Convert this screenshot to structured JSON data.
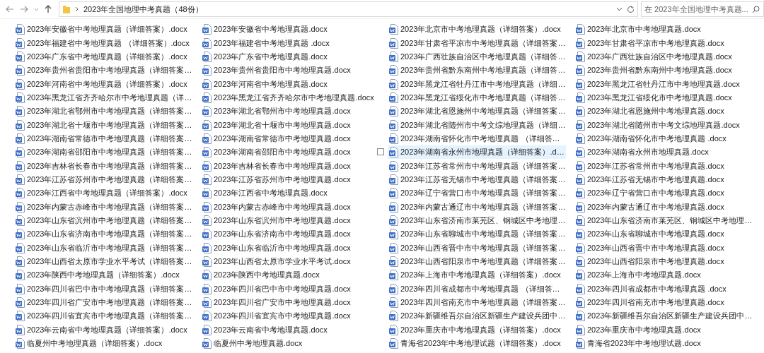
{
  "address_bar": {
    "path": "2023年全国地理中考真题（48份）"
  },
  "search": {
    "placeholder": "在 2023年全国地理中考真题..."
  },
  "columns": [
    {
      "files": [
        {
          "name": "2023年安徽省中考地理真题（详细答案）.docx",
          "selected": false
        },
        {
          "name": "2023年福建省中考地理真题 （详细答案）.docx",
          "selected": false
        },
        {
          "name": "2023年广东省中考地理真题（详细答案）.docx",
          "selected": false
        },
        {
          "name": "2023年贵州省贵阳市中考地理真题（详细答案…",
          "selected": false
        },
        {
          "name": "2023年河南省中考地理真题（详细答案）.docx",
          "selected": false
        },
        {
          "name": "2023年黑龙江省齐齐哈尔市中考地理真题（详…",
          "selected": false
        },
        {
          "name": "2023年湖北省鄂州市中考地理真题（详细答案…",
          "selected": false
        },
        {
          "name": "2023年湖北省十堰市中考地理真题（详细答案…",
          "selected": false
        },
        {
          "name": "2023年湖南省常德市中考地理真题（详细答案…",
          "selected": false
        },
        {
          "name": "2023年湖南省邵阳市中考地理真题（详细答案…",
          "selected": false
        },
        {
          "name": "2023年吉林省长春市中考地理真题（详细答案…",
          "selected": false
        },
        {
          "name": "2023年江苏省苏州市中考地理真题（详细答案…",
          "selected": false
        },
        {
          "name": "2023年江西省中考地理真题（详细答案）.docx",
          "selected": false
        },
        {
          "name": "2023年内蒙古赤峰市中考地理真题（详细答案…",
          "selected": false
        },
        {
          "name": "2023年山东省滨州市中考地理真题（详细答案…",
          "selected": false
        },
        {
          "name": "2023年山东省济南市中考地理真题（详细答案…",
          "selected": false
        },
        {
          "name": "2023年山东省临沂市中考地理真题（详细答案…",
          "selected": false
        },
        {
          "name": "2023年山西省太原市学业水平考试（详细答案…",
          "selected": false
        },
        {
          "name": "2023年陕西中考地理真题（详细答案）.docx",
          "selected": false
        },
        {
          "name": "2023年四川省巴中市中考地理真题（详细答案…",
          "selected": false
        },
        {
          "name": "2023年四川省广安市中考地理真题（详细答案…",
          "selected": false
        },
        {
          "name": "2023年四川省宜宾市中考地理真题（详细答案…",
          "selected": false
        },
        {
          "name": "2023年云南省中考地理真题（详细答案）.docx",
          "selected": false
        },
        {
          "name": "临夏州中考地理真题（详细答案）.docx",
          "selected": false
        }
      ]
    },
    {
      "files": [
        {
          "name": "2023年安徽省中考地理真题.docx",
          "selected": false
        },
        {
          "name": "2023年福建省中考地理真题 .docx",
          "selected": false
        },
        {
          "name": "2023年广东省中考地理真题.docx",
          "selected": false
        },
        {
          "name": "2023年贵州省贵阳市中考地理真题.docx",
          "selected": false
        },
        {
          "name": "2023年河南省中考地理真题.docx",
          "selected": false
        },
        {
          "name": "2023年黑龙江省齐齐哈尔市中考地理真题.docx",
          "selected": false
        },
        {
          "name": "2023年湖北省鄂州市中考地理真题.docx",
          "selected": false
        },
        {
          "name": "2023年湖北省十堰市中考地理真题.docx",
          "selected": false
        },
        {
          "name": "2023年湖南省常德市中考地理真题.docx",
          "selected": false
        },
        {
          "name": "2023年湖南省邵阳市中考地理真题.docx",
          "selected": false
        },
        {
          "name": "2023年吉林省长春市中考地理真题.docx",
          "selected": false
        },
        {
          "name": "2023年江苏省苏州市中考地理真题.docx",
          "selected": false
        },
        {
          "name": "2023年江西省中考地理真题.docx",
          "selected": false
        },
        {
          "name": "2023年内蒙古赤峰市中考地理真题.docx",
          "selected": false
        },
        {
          "name": "2023年山东省滨州市中考地理真题.docx",
          "selected": false
        },
        {
          "name": "2023年山东省济南市中考地理真题.docx",
          "selected": false
        },
        {
          "name": "2023年山东省临沂市中考地理真题.docx",
          "selected": false
        },
        {
          "name": "2023年山西省太原市学业水平考试.docx",
          "selected": false
        },
        {
          "name": "2023年陕西中考地理真题.docx",
          "selected": false
        },
        {
          "name": "2023年四川省巴中市中考地理真题.docx",
          "selected": false
        },
        {
          "name": "2023年四川省广安市中考地理真题.docx",
          "selected": false
        },
        {
          "name": "2023年四川省宜宾市中考地理真题.docx",
          "selected": false
        },
        {
          "name": "2023年云南省中考地理真题.docx",
          "selected": false
        },
        {
          "name": "临夏州中考地理真题.docx",
          "selected": false
        }
      ]
    },
    {
      "files": [
        {
          "name": "2023年北京市中考地理真题（详细答案）.docx",
          "selected": false
        },
        {
          "name": "2023年甘肃省平凉市中考地理真题（详细答案…",
          "selected": false
        },
        {
          "name": "2023年广西壮族自治区中考地理真题（详细答…",
          "selected": false
        },
        {
          "name": "2023年贵州省黔东南州中考地理真题（详细答…",
          "selected": false
        },
        {
          "name": "2023年黑龙江省牡丹江市中考地理真题（详细…",
          "selected": false
        },
        {
          "name": "2023年黑龙江省绥化市中考地理真题（详细答…",
          "selected": false
        },
        {
          "name": "2023年湖北省恩施州中考地理真题（详细答案…",
          "selected": false
        },
        {
          "name": "2023年湖北省随州市中考文综地理真题（详细…",
          "selected": false
        },
        {
          "name": "2023年湖南省怀化市中考地理真题 （详细答…",
          "selected": false
        },
        {
          "name": "2023年湖南省永州市地理真题（详细答案）.d…",
          "selected": true
        },
        {
          "name": "2023年江苏省常州市中考地理真题（详细答案…",
          "selected": false
        },
        {
          "name": "2023年江苏省无锡市中考地理真题（详细答案…",
          "selected": false
        },
        {
          "name": "2023年辽宁省营口市中考地理真题（详细答案…",
          "selected": false
        },
        {
          "name": "2023年内蒙古通辽市中考地理真题（详细答案…",
          "selected": false
        },
        {
          "name": "2023年山东省济南市莱芜区、钢城区中考地理…",
          "selected": false
        },
        {
          "name": "2023年山东省聊城市中考地理真题（详细答案…",
          "selected": false
        },
        {
          "name": "2023年山西省晋中市中考地理真题（详细答案…",
          "selected": false
        },
        {
          "name": "2023年山西省阳泉市中考地理真题（详细答案…",
          "selected": false
        },
        {
          "name": "2023年上海市中考地理真题（详细答案）.docx",
          "selected": false
        },
        {
          "name": "2023年四川省成都市中考地理真题 （详细答…",
          "selected": false
        },
        {
          "name": "2023年四川省南充市中考地理真题（详细答案…",
          "selected": false
        },
        {
          "name": "2023年新疆维吾尔自治区新疆生产建设兵团中…",
          "selected": false
        },
        {
          "name": "2023年重庆市中考地理真题（详细答案）.docx",
          "selected": false
        },
        {
          "name": "青海省2023年中考地理试题（详细答案）.docx",
          "selected": false
        }
      ]
    },
    {
      "files": [
        {
          "name": "2023年北京市中考地理真题.docx",
          "selected": false
        },
        {
          "name": "2023年甘肃省平凉市中考地理真题.docx",
          "selected": false
        },
        {
          "name": "2023年广西壮族自治区中考地理真题.docx",
          "selected": false
        },
        {
          "name": "2023年贵州省黔东南州中考地理真题.docx",
          "selected": false
        },
        {
          "name": "2023年黑龙江省牡丹江市中考地理真题.docx",
          "selected": false
        },
        {
          "name": "2023年黑龙江省绥化市中考地理真题.docx",
          "selected": false
        },
        {
          "name": "2023年湖北省恩施州中考地理真题.docx",
          "selected": false
        },
        {
          "name": "2023年湖北省随州市中考文综地理真题.docx",
          "selected": false
        },
        {
          "name": "2023年湖南省怀化市中考地理真题 .docx",
          "selected": false
        },
        {
          "name": "2023年湖南省永州市地理真题.docx",
          "selected": false
        },
        {
          "name": "2023年江苏省常州市中考地理真题.docx",
          "selected": false
        },
        {
          "name": "2023年江苏省无锡市中考地理真题.docx",
          "selected": false
        },
        {
          "name": "2023年辽宁省营口市中考地理真题.docx",
          "selected": false
        },
        {
          "name": "2023年内蒙古通辽市中考地理真题.docx",
          "selected": false
        },
        {
          "name": "2023年山东省济南市莱芜区、钢城区中考地理…",
          "selected": false
        },
        {
          "name": "2023年山东省聊城市中考地理真题.docx",
          "selected": false
        },
        {
          "name": "2023年山西省晋中市中考地理真题.docx",
          "selected": false
        },
        {
          "name": "2023年山西省阳泉市中考地理真题.docx",
          "selected": false
        },
        {
          "name": "2023年上海市中考地理真题.docx",
          "selected": false
        },
        {
          "name": "2023年四川省成都市中考地理真题 .docx",
          "selected": false
        },
        {
          "name": "2023年四川省南充市中考地理真题.docx",
          "selected": false
        },
        {
          "name": "2023年新疆维吾尔自治区新疆生产建设兵团中…",
          "selected": false
        },
        {
          "name": "2023年重庆市中考地理真题.docx",
          "selected": false
        },
        {
          "name": "青海省2023年中考地理试题.docx",
          "selected": false
        }
      ]
    }
  ]
}
